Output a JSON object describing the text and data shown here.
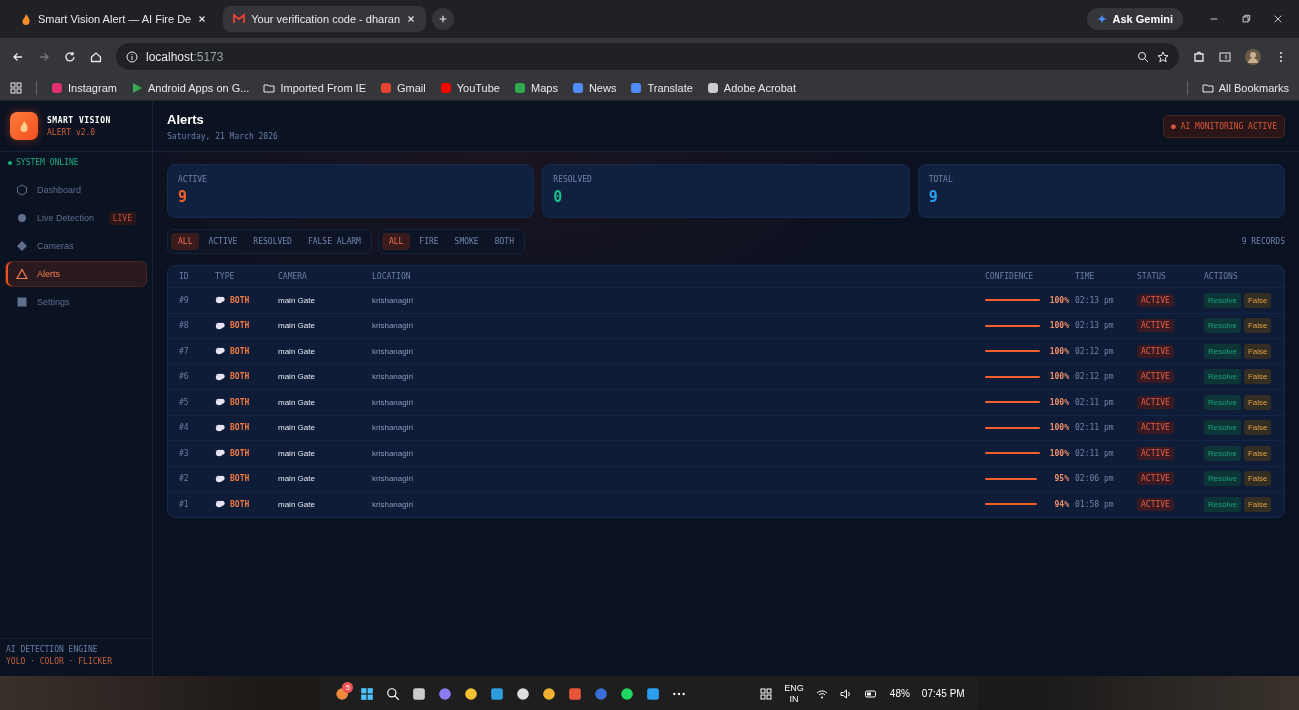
{
  "browser": {
    "tabs": [
      {
        "title": "Smart Vision Alert — AI Fire De",
        "selected": false
      },
      {
        "title": "Your verification code - dharan",
        "selected": true
      }
    ],
    "address": {
      "host": "localhost",
      "port": ":5173"
    },
    "ask_gemini": "Ask Gemini",
    "bookmarks": [
      "Instagram",
      "Android Apps on G...",
      "Imported From IE",
      "Gmail",
      "YouTube",
      "Maps",
      "News",
      "Translate",
      "Adobe Acrobat"
    ],
    "all_bookmarks": "All Bookmarks"
  },
  "sidebar": {
    "brand": {
      "name": "SMART VISION",
      "version": "ALERT v2.0"
    },
    "system_status": "SYSTEM ONLINE",
    "items": [
      {
        "label": "Dashboard",
        "selected": false
      },
      {
        "label": "Live Detection",
        "selected": false,
        "badge": "LIVE"
      },
      {
        "label": "Cameras",
        "selected": false
      },
      {
        "label": "Alerts",
        "selected": true
      },
      {
        "label": "Settings",
        "selected": false
      }
    ],
    "footer": {
      "title": "AI DETECTION ENGINE",
      "subtitle": "YOLO · COLOR · FLICKER"
    }
  },
  "header": {
    "title": "Alerts",
    "date": "Saturday, 21 March 2026",
    "monitor_badge": "● AI MONITORING ACTIVE"
  },
  "stats": [
    {
      "label": "ACTIVE",
      "value": "9",
      "color": "#f5602a"
    },
    {
      "label": "RESOLVED",
      "value": "0",
      "color": "#19c08a"
    },
    {
      "label": "TOTAL",
      "value": "9",
      "color": "#2aa2f0"
    }
  ],
  "filters": {
    "status": [
      {
        "label": "ALL",
        "selected": true
      },
      {
        "label": "ACTIVE",
        "selected": false
      },
      {
        "label": "RESOLVED",
        "selected": false
      },
      {
        "label": "FALSE ALARM",
        "selected": false
      }
    ],
    "type": [
      {
        "label": "ALL",
        "selected": true
      },
      {
        "label": "FIRE",
        "selected": false
      },
      {
        "label": "SMOKE",
        "selected": false
      },
      {
        "label": "BOTH",
        "selected": false
      }
    ],
    "records": "9 RECORDS"
  },
  "table": {
    "columns": [
      "ID",
      "TYPE",
      "CAMERA",
      "LOCATION",
      "CONFIDENCE",
      "TIME",
      "STATUS",
      "ACTIONS"
    ],
    "rows": [
      {
        "id": "#9",
        "type": "BOTH",
        "camera": "main Gate",
        "location": "krishanagiri",
        "confidence": {
          "level": 1,
          "reading": "100%"
        },
        "time": "02:13 pm",
        "status": "ACTIVE",
        "actions": [
          "Resolve",
          "False"
        ]
      },
      {
        "id": "#8",
        "type": "BOTH",
        "camera": "main Gate",
        "location": "krishanagiri",
        "confidence": {
          "level": 1,
          "reading": "100%"
        },
        "time": "02:13 pm",
        "status": "ACTIVE",
        "actions": [
          "Resolve",
          "False"
        ]
      },
      {
        "id": "#7",
        "type": "BOTH",
        "camera": "main Gate",
        "location": "krishanagiri",
        "confidence": {
          "level": 1,
          "reading": "100%"
        },
        "time": "02:12 pm",
        "status": "ACTIVE",
        "actions": [
          "Resolve",
          "False"
        ]
      },
      {
        "id": "#6",
        "type": "BOTH",
        "camera": "main Gate",
        "location": "krishanagiri",
        "confidence": {
          "level": 1,
          "reading": "100%"
        },
        "time": "02:12 pm",
        "status": "ACTIVE",
        "actions": [
          "Resolve",
          "False"
        ]
      },
      {
        "id": "#5",
        "type": "BOTH",
        "camera": "main Gate",
        "location": "krishanagiri",
        "confidence": {
          "level": 1,
          "reading": "100%"
        },
        "time": "02:11 pm",
        "status": "ACTIVE",
        "actions": [
          "Resolve",
          "False"
        ]
      },
      {
        "id": "#4",
        "type": "BOTH",
        "camera": "main Gate",
        "location": "krishanagiri",
        "confidence": {
          "level": 1,
          "reading": "100%"
        },
        "time": "02:11 pm",
        "status": "ACTIVE",
        "actions": [
          "Resolve",
          "False"
        ]
      },
      {
        "id": "#3",
        "type": "BOTH",
        "camera": "main Gate",
        "location": "krishanagiri",
        "confidence": {
          "level": 1,
          "reading": "100%"
        },
        "time": "02:11 pm",
        "status": "ACTIVE",
        "actions": [
          "Resolve",
          "False"
        ]
      },
      {
        "id": "#2",
        "type": "BOTH",
        "camera": "main Gate",
        "location": "krishanagiri",
        "confidence": {
          "level": 0.95,
          "reading": "95%"
        },
        "time": "02:06 pm",
        "status": "ACTIVE",
        "actions": [
          "Resolve",
          "False"
        ]
      },
      {
        "id": "#1",
        "type": "BOTH",
        "camera": "main Gate",
        "location": "krishanagiri",
        "confidence": {
          "level": 0.94,
          "reading": "94%"
        },
        "time": "01:58 pm",
        "status": "ACTIVE",
        "actions": [
          "Resolve",
          "False"
        ]
      }
    ]
  },
  "taskbar": {
    "badge": "5",
    "language": [
      "ENG",
      "IN"
    ],
    "battery": "48%",
    "clock": "07:45 PM"
  }
}
